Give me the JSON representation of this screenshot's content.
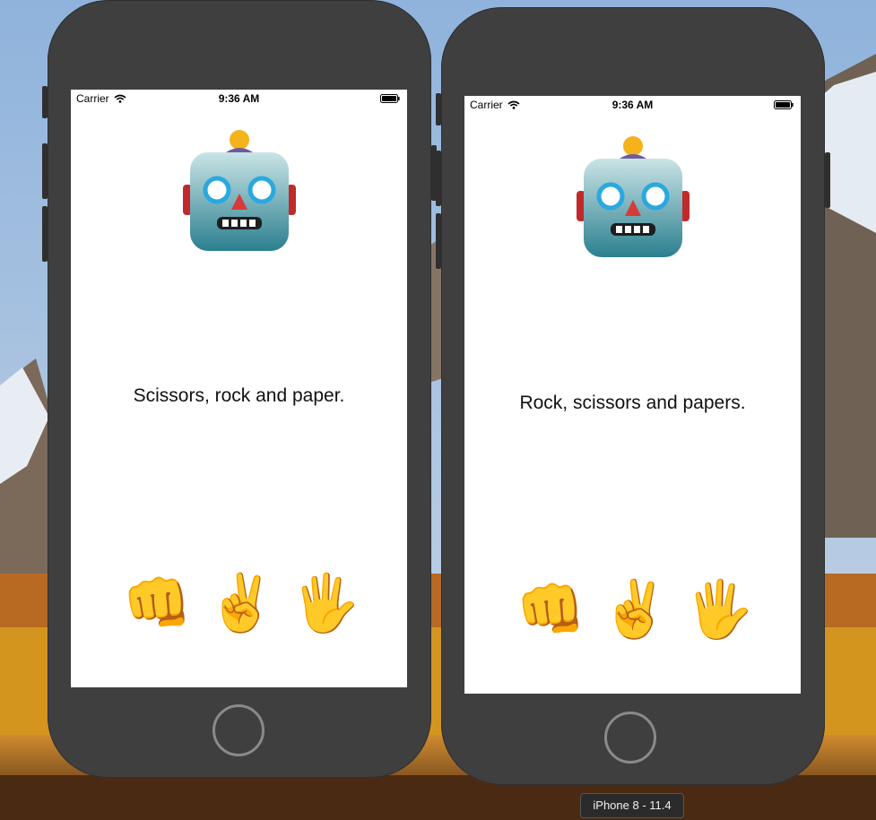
{
  "desktop": {
    "device_label": "iPhone 8 - 11.4"
  },
  "simulators": [
    {
      "status_bar": {
        "carrier": "Carrier",
        "time": "9:36 AM"
      },
      "robot_icon": "robot-face-icon",
      "message": "Scissors, rock and paper.",
      "choices": [
        {
          "name": "rock",
          "glyph": "👊"
        },
        {
          "name": "scissors",
          "glyph": "✌️"
        },
        {
          "name": "paper",
          "glyph": "🖐️"
        }
      ]
    },
    {
      "status_bar": {
        "carrier": "Carrier",
        "time": "9:36 AM"
      },
      "robot_icon": "robot-face-icon",
      "message": "Rock, scissors and papers.",
      "choices": [
        {
          "name": "rock",
          "glyph": "👊"
        },
        {
          "name": "scissors",
          "glyph": "✌️"
        },
        {
          "name": "paper",
          "glyph": "🖐️"
        }
      ]
    }
  ],
  "colors": {
    "phone_body": "#3f3f3f",
    "screen": "#ffffff",
    "home_ring": "#8a8a8a"
  }
}
